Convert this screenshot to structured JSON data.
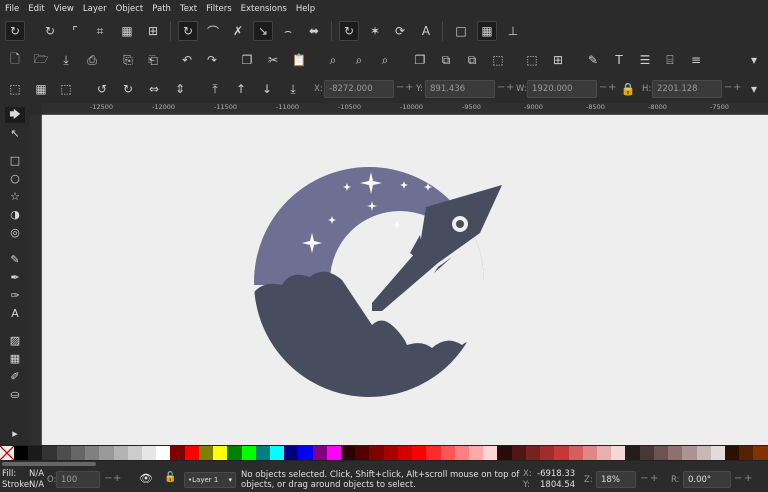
{
  "menu": [
    "File",
    "Edit",
    "View",
    "Layer",
    "Object",
    "Path",
    "Text",
    "Filters",
    "Extensions",
    "Help"
  ],
  "toolbar_xyz": {
    "x_label": "X:",
    "x_value": "-8272.000",
    "y_label": "Y:",
    "y_value": "891.436",
    "w_label": "W:",
    "w_value": "1920.000",
    "h_label": "H:",
    "h_value": "2201.128"
  },
  "ruler": {
    "ticks": [
      "-12500",
      "-12000",
      "-11500",
      "-11000",
      "-10500",
      "-10000",
      "-9500",
      "-9000",
      "-8500",
      "-8000",
      "-7500"
    ]
  },
  "palette": [
    "#000000",
    "#1a1a1a",
    "#333333",
    "#4d4d4d",
    "#666666",
    "#808080",
    "#999999",
    "#b3b3b3",
    "#cccccc",
    "#e6e6e6",
    "#ffffff",
    "#800000",
    "#ff0000",
    "#808000",
    "#ffff00",
    "#008000",
    "#00ff00",
    "#008080",
    "#00ffff",
    "#000080",
    "#0000ff",
    "#800080",
    "#ff00ff",
    "#2b0000",
    "#550000",
    "#800000",
    "#aa0000",
    "#d40000",
    "#ff0000",
    "#ff2a2a",
    "#ff5555",
    "#ff8080",
    "#ffaaaa",
    "#ffd5d5",
    "#280b0b",
    "#501616",
    "#782121",
    "#a02c2c",
    "#c83737",
    "#d35f5f",
    "#de8787",
    "#e9afaf",
    "#f4d7d7",
    "#241c1c",
    "#483737",
    "#6c5353",
    "#916f6f",
    "#ac9393",
    "#c8b7b7",
    "#e3dbdb",
    "#2b1100",
    "#552200",
    "#803300"
  ],
  "status": {
    "fill_label": "Fill:",
    "fill_value": "N/A",
    "stroke_label": "Stroke:",
    "stroke_value": "N/A",
    "opacity_label": "O:",
    "opacity_value": "100",
    "layer": "•Layer 1",
    "message": "No objects selected. Click, Shift+click, Alt+scroll mouse on top of objects, or drag around objects to select.",
    "cursor_x_label": "X:",
    "cursor_x": "-6918.33",
    "cursor_y_label": "Y:",
    "cursor_y": "1804.54",
    "zoom_label": "Z:",
    "zoom": "18%",
    "rotate_label": "R:",
    "rotate": "0.00°"
  },
  "colors": {
    "logo_dark": "#474d5f",
    "logo_sky": "#6f6f93",
    "canvas": "#eeeeee"
  }
}
